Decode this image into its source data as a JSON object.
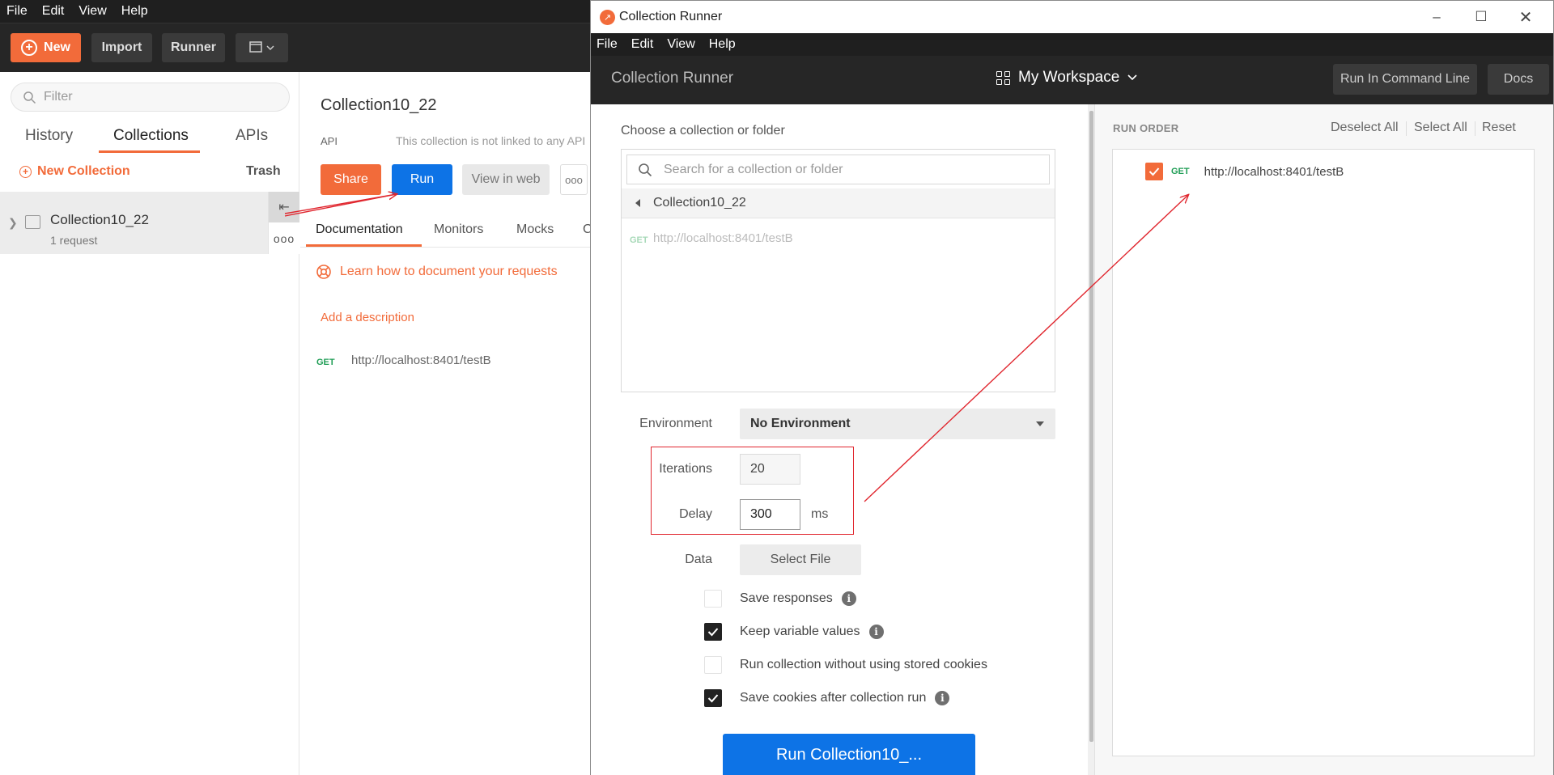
{
  "main_window": {
    "menu": [
      "File",
      "Edit",
      "View",
      "Help"
    ],
    "toolbar": {
      "new_label": "New",
      "import_label": "Import",
      "runner_label": "Runner"
    },
    "sidebar": {
      "filter_placeholder": "Filter",
      "tabs": [
        "History",
        "Collections",
        "APIs"
      ],
      "active_tab": "Collections",
      "new_collection_label": "New Collection",
      "trash_label": "Trash",
      "collections": [
        {
          "name": "Collection10_22",
          "count": "1 request"
        }
      ]
    },
    "main": {
      "title": "Collection10_22",
      "api_label": "API",
      "not_linked_text": "This collection is not linked to any API",
      "share_label": "Share",
      "run_label": "Run",
      "view_in_web_label": "View in web",
      "more_label": "ooo",
      "tabs": [
        "Documentation",
        "Monitors",
        "Mocks",
        "C"
      ],
      "learn_link": "Learn how to document your requests",
      "add_description": "Add a description",
      "request": {
        "method": "GET",
        "url": "http://localhost:8401/testB"
      }
    }
  },
  "runner_window": {
    "title": "Collection Runner",
    "menu": [
      "File",
      "Edit",
      "View",
      "Help"
    ],
    "header": {
      "title": "Collection Runner",
      "workspace": "My Workspace",
      "run_cmdline_label": "Run In Command Line",
      "docs_label": "Docs"
    },
    "left": {
      "choose_label": "Choose a collection or folder",
      "search_placeholder": "Search for a collection or folder",
      "breadcrumb": "Collection10_22",
      "request": {
        "method": "GET",
        "url": "http://localhost:8401/testB"
      },
      "environment_label": "Environment",
      "environment_value": "No Environment",
      "iterations_label": "Iterations",
      "iterations_value": "20",
      "delay_label": "Delay",
      "delay_value": "300",
      "delay_unit": "ms",
      "data_label": "Data",
      "select_file_label": "Select File",
      "options": [
        {
          "label": "Save responses",
          "checked": false,
          "info": true
        },
        {
          "label": "Keep variable values",
          "checked": true,
          "info": true
        },
        {
          "label": "Run collection without using stored cookies",
          "checked": false,
          "info": false
        },
        {
          "label": "Save cookies after collection run",
          "checked": true,
          "info": true
        }
      ],
      "run_button_label": "Run Collection10_..."
    },
    "right": {
      "run_order_label": "RUN ORDER",
      "deselect_all": "Deselect All",
      "select_all": "Select All",
      "reset": "Reset",
      "items": [
        {
          "method": "GET",
          "url": "http://localhost:8401/testB",
          "checked": true
        }
      ]
    }
  },
  "colors": {
    "accent_orange": "#f26b3a",
    "accent_blue": "#0d73e6",
    "annotation_red": "#e0262e",
    "dark_bar": "#262626",
    "get_green": "#1f9d55"
  }
}
